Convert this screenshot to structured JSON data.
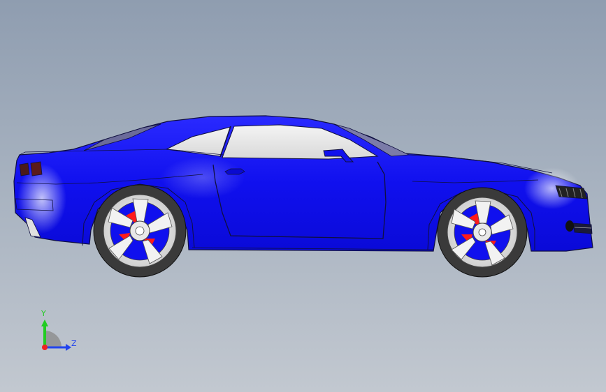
{
  "viewport": {
    "background_top": "#8f9db0",
    "background_bottom": "#c2c8d0"
  },
  "model": {
    "body_color": "#1010ee",
    "glass_color": "#e6e6e6",
    "brake_color": "#ff1a1a",
    "rim_color": "#f2f2f2",
    "tire_color": "#3a3a3a",
    "edge_color": "#101040"
  },
  "triad": {
    "y_label": "Y",
    "z_label": "Z",
    "y_color": "#22cc22",
    "z_color": "#2244ee",
    "x_color": "#ee2222"
  }
}
